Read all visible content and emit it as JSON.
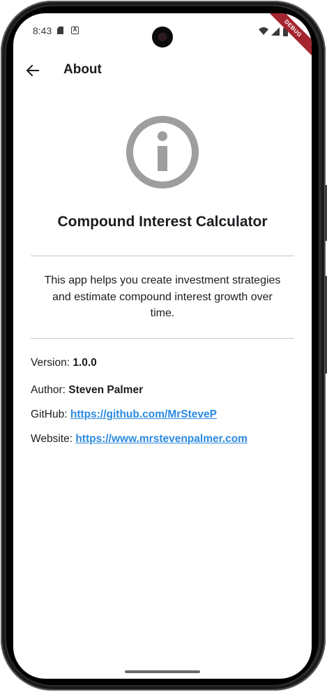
{
  "status_bar": {
    "time": "8:43",
    "sd_icon": "sd-card-icon",
    "a_icon_label": "A",
    "wifi_icon": "wifi-icon",
    "signal_icon": "signal-icon",
    "battery_icon": "battery-icon",
    "debug_label": "DEBUG"
  },
  "app_bar": {
    "back_icon": "arrow-back-icon",
    "title": "About"
  },
  "content": {
    "info_icon": "info-circle-icon",
    "icon_color": "#9e9e9e",
    "app_name": "Compound Interest Calculator",
    "description": "This app helps you create investment strategies and estimate compound interest growth over time.",
    "version_label": "Version: ",
    "version_value": "1.0.0",
    "author_label": "Author: ",
    "author_value": "Steven Palmer",
    "github_label": "GitHub: ",
    "github_url": "https://github.com/MrSteveP",
    "website_label": "Website: ",
    "website_url": "https://www.mrstevenpalmer.com",
    "link_color": "#2c8ae0"
  }
}
